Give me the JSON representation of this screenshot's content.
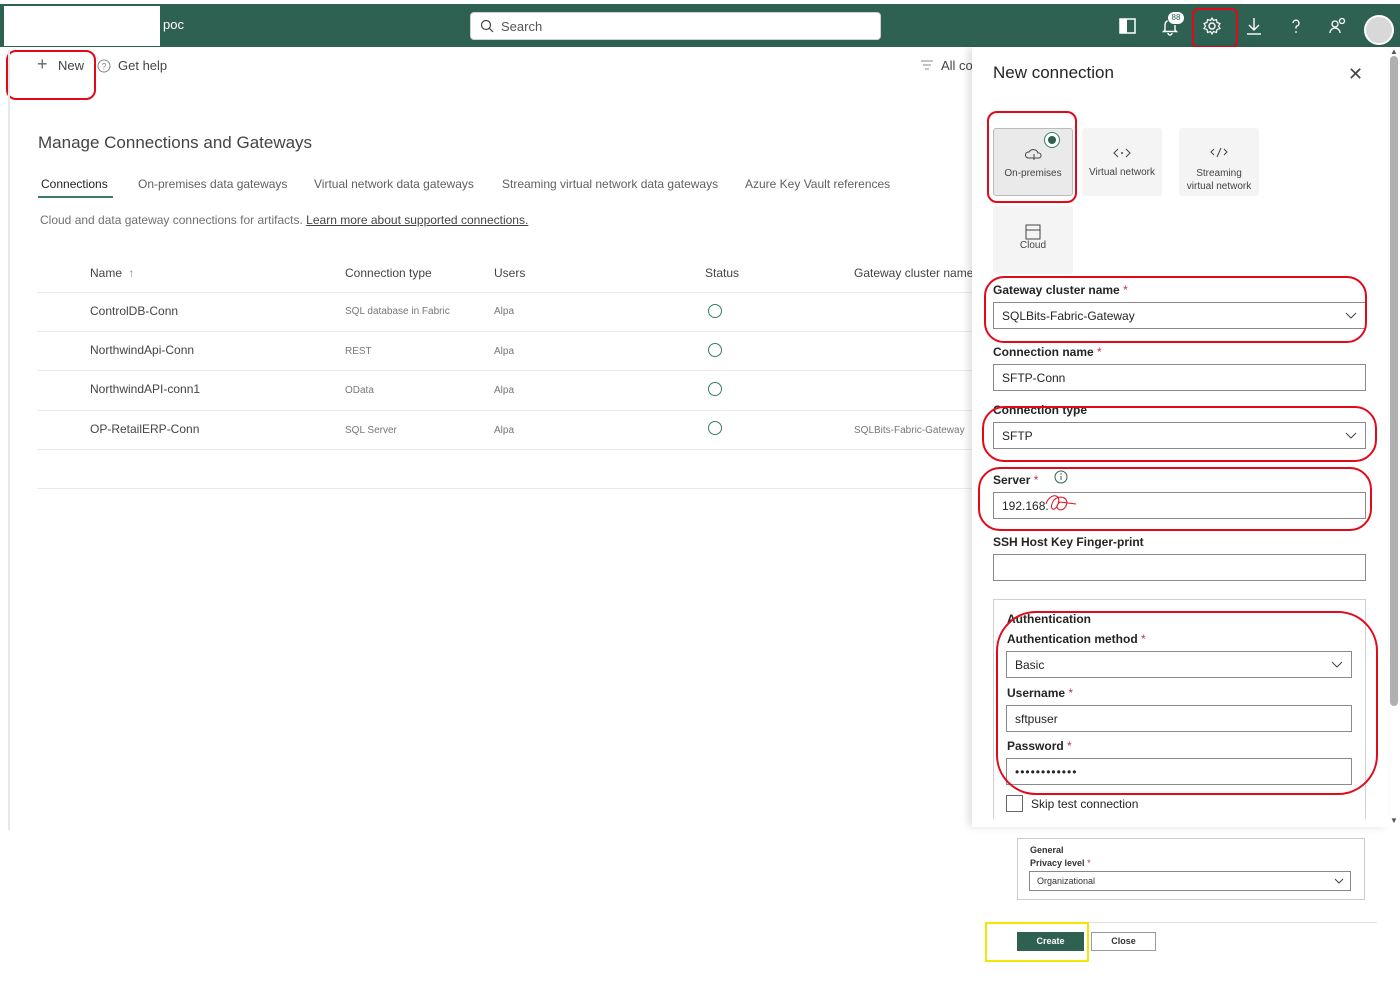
{
  "topbar": {
    "workspace": "poc",
    "search_placeholder": "Search",
    "notification_count": "88"
  },
  "commandbar": {
    "new_label": "New",
    "help_label": "Get help",
    "filter_label": "All co"
  },
  "main": {
    "title": "Manage Connections and Gateways",
    "tabs": [
      {
        "label": "Connections"
      },
      {
        "label": "On-premises data gateways"
      },
      {
        "label": "Virtual network data gateways"
      },
      {
        "label": "Streaming virtual network data gateways"
      },
      {
        "label": "Azure Key Vault references"
      }
    ],
    "description": "Cloud and data gateway connections for artifacts.",
    "learn_more": "Learn more about supported connections.",
    "columns": {
      "name": "Name",
      "sort_glyph": "↑",
      "type": "Connection type",
      "users": "Users",
      "status": "Status",
      "gateway": "Gateway cluster name"
    },
    "rows": [
      {
        "name": "ControlDB-Conn",
        "type": "SQL database in Fabric",
        "users": "Alpa",
        "gateway": ""
      },
      {
        "name": "NorthwindApi-Conn",
        "type": "REST",
        "users": "Alpa",
        "gateway": ""
      },
      {
        "name": "NorthwindAPI-conn1",
        "type": "OData",
        "users": "Alpa",
        "gateway": ""
      },
      {
        "name": "OP-RetailERP-Conn",
        "type": "SQL Server",
        "users": "Alpa",
        "gateway": "SQLBits-Fabric-Gateway"
      }
    ]
  },
  "panel": {
    "title": "New connection",
    "close_glyph": "✕",
    "types": [
      {
        "label": "On-premises"
      },
      {
        "label": "Virtual network"
      },
      {
        "label": "Streaming virtual network"
      },
      {
        "label": "Cloud"
      }
    ],
    "gateway_label": "Gateway cluster name",
    "gateway_value": "SQLBits-Fabric-Gateway",
    "conn_name_label": "Connection name",
    "conn_name_value": "SFTP-Conn",
    "conn_type_label": "Connection type",
    "conn_type_value": "SFTP",
    "server_label": "Server",
    "server_value": "192.168.",
    "ssh_label": "SSH Host Key Finger-print",
    "ssh_value": "",
    "auth_section": "Authentication",
    "auth_method_label": "Authentication method",
    "auth_method_value": "Basic",
    "username_label": "Username",
    "username_value": "sftpuser",
    "password_label": "Password",
    "password_value": "••••••••••••",
    "skip_test_label": "Skip test connection",
    "required_mark": "*"
  },
  "footer": {
    "general_label": "General",
    "privacy_label": "Privacy level",
    "privacy_value": "Organizational",
    "create_label": "Create",
    "close_label": "Close"
  },
  "colors": {
    "brand": "#2f6152",
    "highlight_red": "#e00a1a",
    "highlight_yellow": "#f5e600"
  }
}
